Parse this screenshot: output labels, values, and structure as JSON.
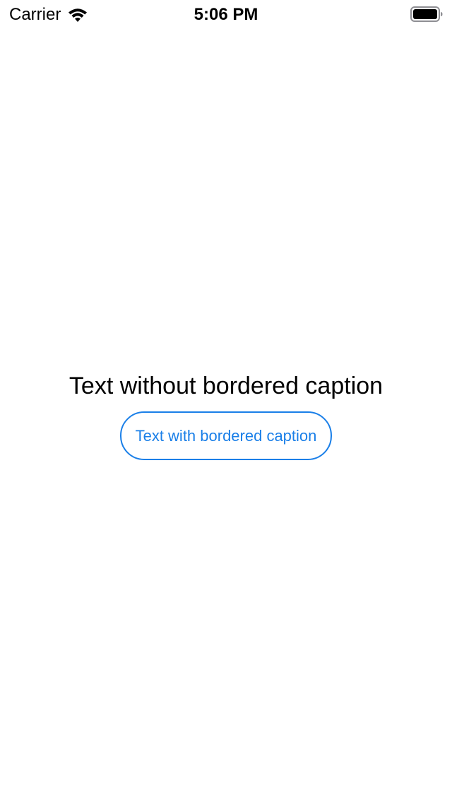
{
  "status_bar": {
    "carrier": "Carrier",
    "time": "5:06 PM",
    "icons": {
      "wifi": "wifi-icon",
      "battery": "battery-icon"
    }
  },
  "main": {
    "plain_caption": "Text without bordered caption",
    "bordered_caption": "Text with bordered caption"
  },
  "colors": {
    "accent": "#1a7fe8",
    "text": "#000000",
    "background": "#ffffff"
  }
}
